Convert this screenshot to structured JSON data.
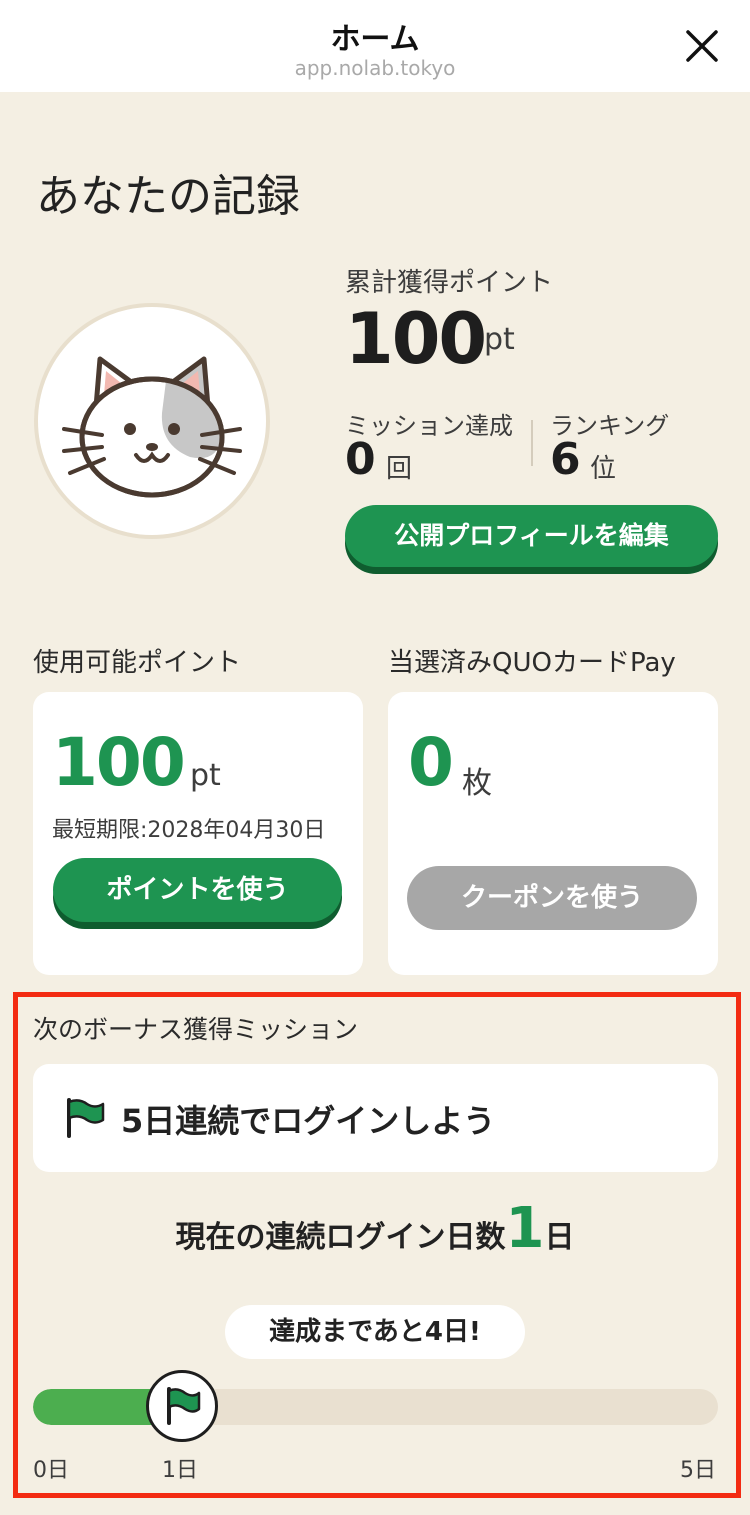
{
  "browser": {
    "title": "ホーム",
    "url": "app.nolab.tokyo"
  },
  "record": {
    "heading": "あなたの記録",
    "total_points_label": "累計獲得ポイント",
    "total_points_value": "100",
    "total_points_unit": "pt",
    "mission_label": "ミッション達成",
    "mission_value": "0",
    "mission_unit": "回",
    "ranking_label": "ランキング",
    "ranking_value": "6",
    "ranking_unit": "位",
    "edit_profile_button": "公開プロフィールを編集"
  },
  "usable_points": {
    "label": "使用可能ポイント",
    "value": "100",
    "unit": "pt",
    "expiry": "最短期限:2028年04月30日",
    "button": "ポイントを使う"
  },
  "quo": {
    "label": "当選済みQUOカードPay",
    "value": "0",
    "unit": "枚",
    "button": "クーポンを使う"
  },
  "bonus": {
    "section_label": "次のボーナス獲得ミッション",
    "mission_title": "5日連続でログインしよう",
    "streak_prefix": "現在の連続ログイン日数",
    "streak_value": "1",
    "streak_suffix": "日",
    "remaining": "達成まであと4日!",
    "progress_current_days": 1,
    "progress_goal_days": 5,
    "tick_start": "0日",
    "tick_current": "1日",
    "tick_end": "5日"
  },
  "colors": {
    "accent_green": "#1e9451",
    "progress_green": "#4cae4f",
    "highlight_red": "#f32b12",
    "background": "#f4efe3"
  },
  "icons": {
    "close": "close-icon",
    "avatar": "cat-avatar-icon",
    "flag": "flag-icon"
  }
}
